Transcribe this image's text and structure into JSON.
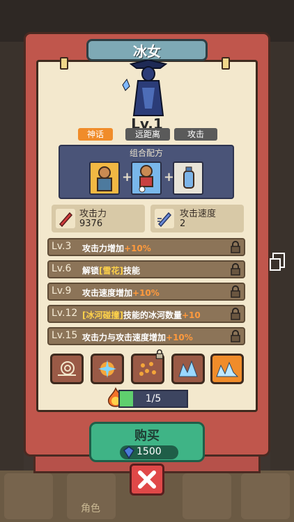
{
  "hero": {
    "name": "冰女",
    "level": "Lv.1"
  },
  "tags": [
    "神话",
    "远距离",
    "攻击"
  ],
  "recipe": {
    "title": "组合配方"
  },
  "stats": [
    {
      "label": "攻击力",
      "value": "9376"
    },
    {
      "label": "攻击速度",
      "value": "2"
    }
  ],
  "perks": [
    {
      "level": "Lv.3",
      "text": "攻击力增加",
      "bonus": "+10%"
    },
    {
      "level": "Lv.6",
      "pre": "解锁",
      "skill": "[雪花]",
      "post": "技能"
    },
    {
      "level": "Lv.9",
      "text": "攻击速度增加",
      "bonus": "+10%"
    },
    {
      "level": "Lv.12",
      "skill": "[冰河碰撞]",
      "post": "技能的冰河数量",
      "bonus": "+10"
    },
    {
      "level": "Lv.15",
      "text": "攻击力与攻击速度增加",
      "bonus": "+10%"
    }
  ],
  "progress": {
    "text": "1/5",
    "fraction": 0.2
  },
  "buy": {
    "label": "购买",
    "price": "1500"
  },
  "bottom_nav": {
    "tab_label": "角色"
  },
  "colors": {
    "accent_orange": "#f08c2a",
    "tag_gray": "#5a5a5a",
    "buy_green": "#3fb486",
    "close_red": "#e04848"
  }
}
